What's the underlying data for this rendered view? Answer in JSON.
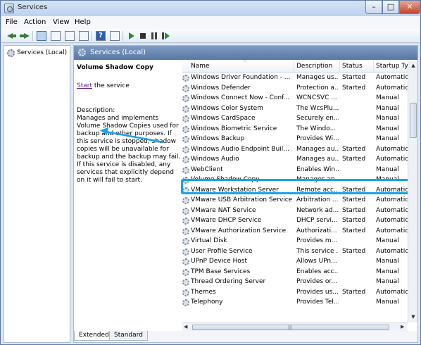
{
  "window": {
    "title": "Services",
    "controls": {
      "minimize": "–",
      "maximize": "□",
      "close": "✕"
    }
  },
  "menu": [
    "File",
    "Action",
    "View",
    "Help"
  ],
  "toolbar": {
    "icons": [
      "back-arrow-icon",
      "forward-arrow-icon",
      "console-tree-icon",
      "properties-icon",
      "refresh-icon",
      "export-list-icon",
      "help-icon",
      "show-hide-icon",
      "start-service-icon",
      "stop-service-icon",
      "pause-service-icon",
      "restart-service-icon"
    ],
    "help_glyph": "?"
  },
  "nav": {
    "item": "Services (Local)"
  },
  "pane": {
    "header": "Services (Local)",
    "selected_service": "Volume Shadow Copy",
    "start_link": "Start",
    "start_suffix": " the service",
    "description_label": "Description:",
    "description": "Manages and implements Volume Shadow Copies used for backup and other purposes. If this service is stopped, shadow copies will be unavailable for backup and the backup may fail. If this service is disabled, any services that explicitly depend on it will fail to start."
  },
  "columns": [
    "Name",
    "Description",
    "Status",
    "Startup Typ"
  ],
  "services": [
    [
      "Windows Driver Foundation - ...",
      "Manages us...",
      "Started",
      "Automatic"
    ],
    [
      "Windows Defender",
      "Protection a...",
      "Started",
      "Automatic"
    ],
    [
      "Windows Connect Now - Conf...",
      "WCNCSVC ...",
      "",
      "Manual"
    ],
    [
      "Windows Color System",
      "The WcsPlu...",
      "",
      "Manual"
    ],
    [
      "Windows CardSpace",
      "Securely en...",
      "",
      "Manual"
    ],
    [
      "Windows Biometric Service",
      "The Windo...",
      "",
      "Manual"
    ],
    [
      "Windows Backup",
      "Provides Wi...",
      "",
      "Manual"
    ],
    [
      "Windows Audio Endpoint Buil...",
      "Manages au...",
      "Started",
      "Automatic"
    ],
    [
      "Windows Audio",
      "Manages au...",
      "Started",
      "Automatic"
    ],
    [
      "WebClient",
      "Enables Win...",
      "",
      "Manual"
    ],
    [
      "Volume Shadow Copy",
      "Manages an...",
      "",
      "Manual"
    ],
    [
      "VMware Workstation Server",
      "Remote acc...",
      "Started",
      "Automatic"
    ],
    [
      "VMware USB Arbitration Service",
      "Arbitration ...",
      "Started",
      "Automatic"
    ],
    [
      "VMware NAT Service",
      "Network ad...",
      "Started",
      "Automatic"
    ],
    [
      "VMware DHCP Service",
      "DHCP servi...",
      "Started",
      "Automatic"
    ],
    [
      "VMware Authorization Service",
      "Authorizati...",
      "Started",
      "Automatic"
    ],
    [
      "Virtual Disk",
      "Provides m...",
      "",
      "Manual"
    ],
    [
      "User Profile Service",
      "This service ...",
      "Started",
      "Automatic"
    ],
    [
      "UPnP Device Host",
      "Allows UPn...",
      "",
      "Manual"
    ],
    [
      "TPM Base Services",
      "Enables acc...",
      "",
      "Manual"
    ],
    [
      "Thread Ordering Server",
      "Provides or...",
      "",
      "Manual"
    ],
    [
      "Themes",
      "Provides us...",
      "Started",
      "Automatic"
    ],
    [
      "Telephony",
      "Provides Tel...",
      "",
      "Manual"
    ]
  ],
  "tabs": [
    "Extended",
    "Standard"
  ],
  "highlight_color": "#1aa3e8",
  "arrow_color": "#1aa3e8"
}
